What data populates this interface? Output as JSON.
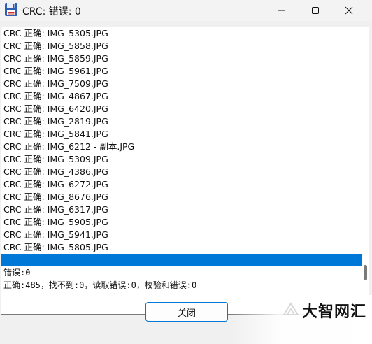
{
  "window": {
    "title": "CRC: 错误: 0",
    "icon": "floppy-disk-icon"
  },
  "list": {
    "lines": [
      "CRC 正确: IMG_5305.JPG",
      "CRC 正确: IMG_5858.JPG",
      "CRC 正确: IMG_5859.JPG",
      "CRC 正确: IMG_5961.JPG",
      "CRC 正确: IMG_7509.JPG",
      "CRC 正确: IMG_4867.JPG",
      "CRC 正确: IMG_6420.JPG",
      "CRC 正确: IMG_2819.JPG",
      "CRC 正确: IMG_5841.JPG",
      "CRC 正确: IMG_6212 - 副本.JPG",
      "CRC 正确: IMG_5309.JPG",
      "CRC 正确: IMG_4386.JPG",
      "CRC 正确: IMG_6272.JPG",
      "CRC 正确: IMG_8676.JPG",
      "CRC 正确: IMG_6317.JPG",
      "CRC 正确: IMG_5905.JPG",
      "CRC 正确: IMG_5941.JPG",
      "CRC 正确: IMG_5805.JPG"
    ],
    "selected_line": "",
    "summary_errors": "错误:0",
    "summary_detail": "正确:485，找不到:0，读取错误:0，校验和错误:0"
  },
  "buttons": {
    "close_label": "关闭"
  },
  "watermark": {
    "text": "大智网汇"
  }
}
